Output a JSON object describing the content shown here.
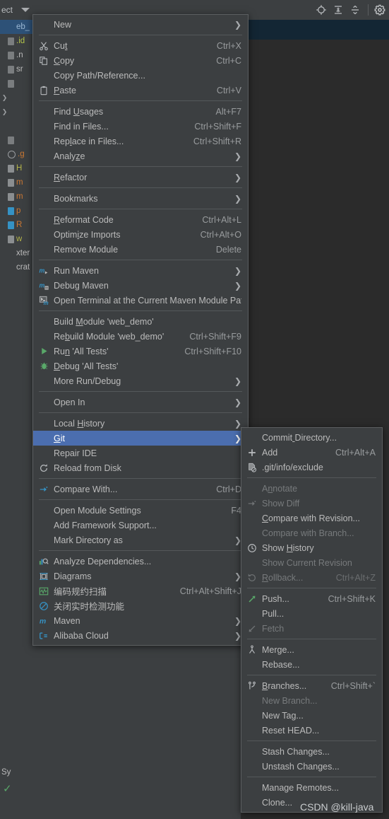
{
  "toolbar": {
    "title": "ect",
    "icons": [
      {
        "name": "locate-icon",
        "glyph": "locate"
      },
      {
        "name": "expand-all-icon",
        "glyph": "expand"
      },
      {
        "name": "collapse-all-icon",
        "glyph": "collapse"
      },
      {
        "name": "settings-gear-icon",
        "glyph": "gear"
      }
    ]
  },
  "project_tree": {
    "rows": [
      {
        "label": "eb_",
        "kind": "module",
        "selected": true,
        "color": "#9ab7d3",
        "marker": "none"
      },
      {
        "label": ".id",
        "kind": "folder",
        "selected": false,
        "color": "#b3c44a",
        "marker": "folder"
      },
      {
        "label": ".n",
        "kind": "folder",
        "selected": false,
        "color": "#bbbbbb",
        "marker": "folder"
      },
      {
        "label": "sr",
        "kind": "folder",
        "selected": false,
        "color": "#bbbbbb",
        "marker": "folder"
      },
      {
        "label": "",
        "kind": "file",
        "selected": false,
        "color": "#bbbbbb",
        "marker": "file"
      },
      {
        "label": "",
        "kind": "expand",
        "selected": false,
        "color": "#bbbbbb",
        "marker": "tri"
      },
      {
        "label": "",
        "kind": "expand",
        "selected": false,
        "color": "#bbbbbb",
        "marker": "tri"
      },
      {
        "label": "",
        "kind": "blank",
        "selected": false,
        "color": "#bbbbbb",
        "marker": "none"
      },
      {
        "label": "",
        "kind": "file",
        "selected": false,
        "color": "#bbbbbb",
        "marker": "file"
      },
      {
        "label": ".g",
        "kind": "file",
        "selected": false,
        "color": "#cc7832",
        "marker": "circle"
      },
      {
        "label": "H",
        "kind": "file",
        "selected": false,
        "color": "#b3b34a",
        "marker": "sq"
      },
      {
        "label": "m",
        "kind": "file",
        "selected": false,
        "color": "#cc7832",
        "marker": "sq"
      },
      {
        "label": "m",
        "kind": "file",
        "selected": false,
        "color": "#cc7832",
        "marker": "sq"
      },
      {
        "label": "p",
        "kind": "file",
        "selected": false,
        "color": "#cc7832",
        "marker": "sqblue"
      },
      {
        "label": "R",
        "kind": "file",
        "selected": false,
        "color": "#cc7832",
        "marker": "sqblue"
      },
      {
        "label": "w",
        "kind": "file",
        "selected": false,
        "color": "#b3b34a",
        "marker": "sq"
      },
      {
        "label": "xter",
        "kind": "text",
        "selected": false,
        "color": "#bbbbbb",
        "marker": "none"
      },
      {
        "label": "crat",
        "kind": "text",
        "selected": false,
        "color": "#bbbbbb",
        "marker": "none"
      }
    ],
    "bottom_label": "Sy"
  },
  "context_menu": {
    "name": "project-context-menu",
    "items": [
      {
        "label": "New",
        "key": "",
        "icon": "",
        "submenu": true,
        "disabled": false,
        "mnemonic": -1
      },
      {
        "sep": true
      },
      {
        "label": "Cut",
        "key": "Ctrl+X",
        "icon": "scissors",
        "submenu": false,
        "disabled": false,
        "mnemonic": 2
      },
      {
        "label": "Copy",
        "key": "Ctrl+C",
        "icon": "copy",
        "submenu": false,
        "disabled": false,
        "mnemonic": 0
      },
      {
        "label": "Copy Path/Reference...",
        "key": "",
        "icon": "",
        "submenu": false,
        "disabled": false,
        "mnemonic": -1
      },
      {
        "label": "Paste",
        "key": "Ctrl+V",
        "icon": "clipboard",
        "submenu": false,
        "disabled": false,
        "mnemonic": 0
      },
      {
        "sep": true
      },
      {
        "label": "Find Usages",
        "key": "Alt+F7",
        "icon": "",
        "submenu": false,
        "disabled": false,
        "mnemonic": 5
      },
      {
        "label": "Find in Files...",
        "key": "Ctrl+Shift+F",
        "icon": "",
        "submenu": false,
        "disabled": false,
        "mnemonic": -1
      },
      {
        "label": "Replace in Files...",
        "key": "Ctrl+Shift+R",
        "icon": "",
        "submenu": false,
        "disabled": false,
        "mnemonic": 3
      },
      {
        "label": "Analyze",
        "key": "",
        "icon": "",
        "submenu": true,
        "disabled": false,
        "mnemonic": 5
      },
      {
        "sep": true
      },
      {
        "label": "Refactor",
        "key": "",
        "icon": "",
        "submenu": true,
        "disabled": false,
        "mnemonic": 0
      },
      {
        "sep": true
      },
      {
        "label": "Bookmarks",
        "key": "",
        "icon": "",
        "submenu": true,
        "disabled": false,
        "mnemonic": -1
      },
      {
        "sep": true
      },
      {
        "label": "Reformat Code",
        "key": "Ctrl+Alt+L",
        "icon": "",
        "submenu": false,
        "disabled": false,
        "mnemonic": 0
      },
      {
        "label": "Optimize Imports",
        "key": "Ctrl+Alt+O",
        "icon": "",
        "submenu": false,
        "disabled": false,
        "mnemonic": 5
      },
      {
        "label": "Remove Module",
        "key": "Delete",
        "icon": "",
        "submenu": false,
        "disabled": false,
        "mnemonic": -1
      },
      {
        "sep": true
      },
      {
        "label": "Run Maven",
        "key": "",
        "icon": "maven-run",
        "submenu": true,
        "disabled": false,
        "mnemonic": -1
      },
      {
        "label": "Debug Maven",
        "key": "",
        "icon": "maven-debug",
        "submenu": true,
        "disabled": false,
        "mnemonic": -1
      },
      {
        "label": "Open Terminal at the Current Maven Module Path",
        "key": "",
        "icon": "terminal-maven",
        "submenu": false,
        "disabled": false,
        "mnemonic": -1
      },
      {
        "sep": true
      },
      {
        "label": "Build Module 'web_demo'",
        "key": "",
        "icon": "",
        "submenu": false,
        "disabled": false,
        "mnemonic": 6
      },
      {
        "label": "Rebuild Module 'web_demo'",
        "key": "Ctrl+Shift+F9",
        "icon": "",
        "submenu": false,
        "disabled": false,
        "mnemonic": 2
      },
      {
        "label": "Run 'All Tests'",
        "key": "Ctrl+Shift+F10",
        "icon": "run-green",
        "submenu": false,
        "disabled": false,
        "mnemonic": 2
      },
      {
        "label": "Debug 'All Tests'",
        "key": "",
        "icon": "debug-bug",
        "submenu": false,
        "disabled": false,
        "mnemonic": 0
      },
      {
        "label": "More Run/Debug",
        "key": "",
        "icon": "",
        "submenu": true,
        "disabled": false,
        "mnemonic": -1
      },
      {
        "sep": true
      },
      {
        "label": "Open In",
        "key": "",
        "icon": "",
        "submenu": true,
        "disabled": false,
        "mnemonic": -1
      },
      {
        "sep": true
      },
      {
        "label": "Local History",
        "key": "",
        "icon": "",
        "submenu": true,
        "disabled": false,
        "mnemonic": 6
      },
      {
        "label": "Git",
        "key": "",
        "icon": "",
        "submenu": true,
        "disabled": false,
        "mnemonic": 0,
        "selected": true
      },
      {
        "label": "Repair IDE",
        "key": "",
        "icon": "",
        "submenu": false,
        "disabled": false,
        "mnemonic": -1
      },
      {
        "label": "Reload from Disk",
        "key": "",
        "icon": "reload",
        "submenu": false,
        "disabled": false,
        "mnemonic": -1
      },
      {
        "sep": true
      },
      {
        "label": "Compare With...",
        "key": "Ctrl+D",
        "icon": "compare",
        "submenu": false,
        "disabled": false,
        "mnemonic": -1
      },
      {
        "sep": true
      },
      {
        "label": "Open Module Settings",
        "key": "F4",
        "icon": "",
        "submenu": false,
        "disabled": false,
        "mnemonic": -1
      },
      {
        "label": "Add Framework Support...",
        "key": "",
        "icon": "",
        "submenu": false,
        "disabled": false,
        "mnemonic": -1
      },
      {
        "label": "Mark Directory as",
        "key": "",
        "icon": "",
        "submenu": true,
        "disabled": false,
        "mnemonic": -1
      },
      {
        "sep": true
      },
      {
        "label": "Analyze Dependencies...",
        "key": "",
        "icon": "analyze-dep",
        "submenu": false,
        "disabled": false,
        "mnemonic": -1
      },
      {
        "label": "Diagrams",
        "key": "",
        "icon": "diagrams",
        "submenu": true,
        "disabled": false,
        "mnemonic": -1
      },
      {
        "label": "编码规约扫描",
        "key": "Ctrl+Alt+Shift+J",
        "icon": "scan-green",
        "submenu": false,
        "disabled": false,
        "mnemonic": -1
      },
      {
        "label": "关闭实时检测功能",
        "key": "",
        "icon": "disable-blue",
        "submenu": false,
        "disabled": false,
        "mnemonic": -1
      },
      {
        "label": "Maven",
        "key": "",
        "icon": "maven-m",
        "submenu": true,
        "disabled": false,
        "mnemonic": -1
      },
      {
        "label": "Alibaba Cloud",
        "key": "",
        "icon": "alibaba",
        "submenu": true,
        "disabled": false,
        "mnemonic": -1
      }
    ]
  },
  "git_submenu": {
    "name": "git-submenu",
    "items": [
      {
        "label": "Commit Directory...",
        "key": "",
        "icon": "",
        "submenu": false,
        "disabled": false,
        "mnemonic": 6
      },
      {
        "label": "Add",
        "key": "Ctrl+Alt+A",
        "icon": "plus",
        "submenu": false,
        "disabled": false,
        "mnemonic": -1
      },
      {
        "label": ".git/info/exclude",
        "key": "",
        "icon": "file-exclude",
        "submenu": false,
        "disabled": false,
        "mnemonic": -1
      },
      {
        "sep": true
      },
      {
        "label": "Annotate",
        "key": "",
        "icon": "",
        "submenu": false,
        "disabled": true,
        "mnemonic": 1
      },
      {
        "label": "Show Diff",
        "key": "",
        "icon": "compare",
        "submenu": false,
        "disabled": true,
        "mnemonic": -1
      },
      {
        "label": "Compare with Revision...",
        "key": "",
        "icon": "",
        "submenu": false,
        "disabled": false,
        "mnemonic": 0
      },
      {
        "label": "Compare with Branch...",
        "key": "",
        "icon": "",
        "submenu": false,
        "disabled": true,
        "mnemonic": -1
      },
      {
        "label": "Show History",
        "key": "",
        "icon": "clock",
        "submenu": false,
        "disabled": false,
        "mnemonic": 5
      },
      {
        "label": "Show Current Revision",
        "key": "",
        "icon": "",
        "submenu": false,
        "disabled": true,
        "mnemonic": -1
      },
      {
        "label": "Rollback...",
        "key": "Ctrl+Alt+Z",
        "icon": "rollback",
        "submenu": false,
        "disabled": true,
        "mnemonic": 0
      },
      {
        "sep": true
      },
      {
        "label": "Push...",
        "key": "Ctrl+Shift+K",
        "icon": "push-arrow",
        "submenu": false,
        "disabled": false,
        "mnemonic": -1
      },
      {
        "label": "Pull...",
        "key": "",
        "icon": "",
        "submenu": false,
        "disabled": false,
        "mnemonic": -1
      },
      {
        "label": "Fetch",
        "key": "",
        "icon": "fetch-arrow",
        "submenu": false,
        "disabled": true,
        "mnemonic": -1
      },
      {
        "sep": true
      },
      {
        "label": "Merge...",
        "key": "",
        "icon": "merge",
        "submenu": false,
        "disabled": false,
        "mnemonic": -1
      },
      {
        "label": "Rebase...",
        "key": "",
        "icon": "",
        "submenu": false,
        "disabled": false,
        "mnemonic": -1
      },
      {
        "sep": true
      },
      {
        "label": "Branches...",
        "key": "Ctrl+Shift+`",
        "icon": "branch",
        "submenu": false,
        "disabled": false,
        "mnemonic": 0
      },
      {
        "label": "New Branch...",
        "key": "",
        "icon": "",
        "submenu": false,
        "disabled": true,
        "mnemonic": -1
      },
      {
        "label": "New Tag...",
        "key": "",
        "icon": "",
        "submenu": false,
        "disabled": false,
        "mnemonic": -1
      },
      {
        "label": "Reset HEAD...",
        "key": "",
        "icon": "",
        "submenu": false,
        "disabled": false,
        "mnemonic": -1
      },
      {
        "sep": true
      },
      {
        "label": "Stash Changes...",
        "key": "",
        "icon": "",
        "submenu": false,
        "disabled": false,
        "mnemonic": -1
      },
      {
        "label": "Unstash Changes...",
        "key": "",
        "icon": "",
        "submenu": false,
        "disabled": false,
        "mnemonic": -1
      },
      {
        "sep": true
      },
      {
        "label": "Manage Remotes...",
        "key": "",
        "icon": "",
        "submenu": false,
        "disabled": false,
        "mnemonic": -1
      },
      {
        "label": "Clone...",
        "key": "",
        "icon": "",
        "submenu": false,
        "disabled": false,
        "mnemonic": -1
      }
    ]
  },
  "watermark": {
    "text": "CSDN @kill-java"
  },
  "colors": {
    "menu_bg": "#3c3f41",
    "menu_border": "#5c5f61",
    "text": "#bbbbbb",
    "text_disabled": "#777a7c",
    "highlight": "#4b6eaf",
    "accent_green": "#59a869",
    "accent_blue": "#3592c4",
    "editor_bg": "#132634"
  }
}
